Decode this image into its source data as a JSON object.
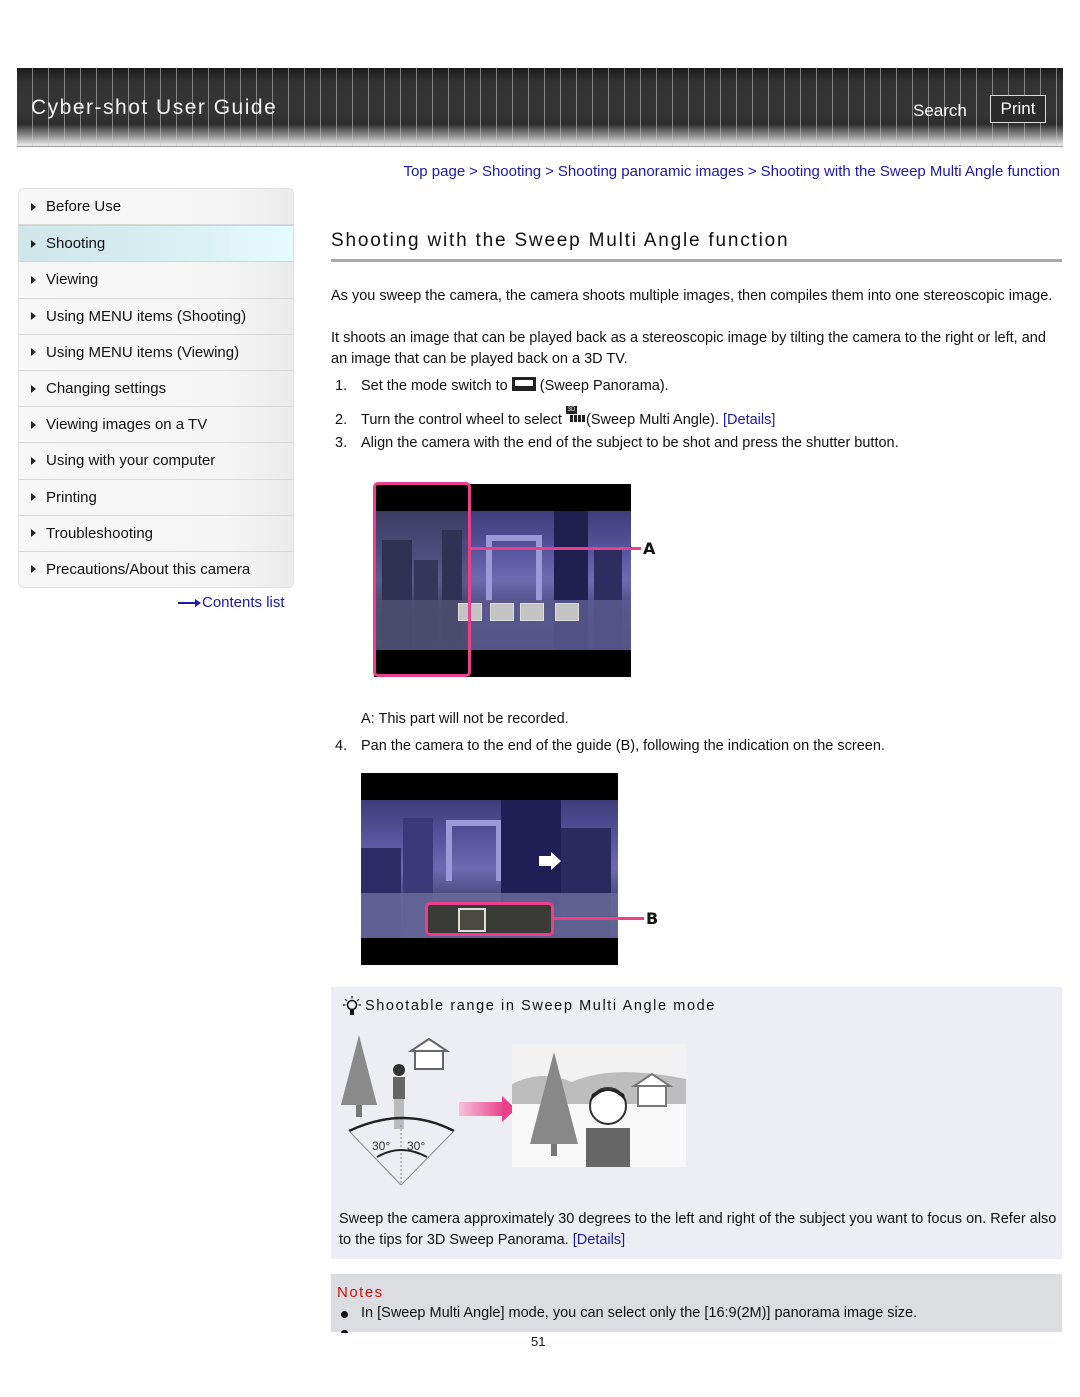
{
  "header": {
    "app_title": "Cyber-shot User Guide",
    "search_label": "Search",
    "print_label": "Print"
  },
  "breadcrumb": {
    "items": [
      "Top page",
      "Shooting",
      "Shooting panoramic images",
      "Shooting with the Sweep Multi Angle function"
    ],
    "separator": ">"
  },
  "sidebar": {
    "items": [
      {
        "label": "Before Use",
        "active": false
      },
      {
        "label": "Shooting",
        "active": true
      },
      {
        "label": "Viewing",
        "active": false
      },
      {
        "label": "Using MENU items (Shooting)",
        "active": false
      },
      {
        "label": "Using MENU items (Viewing)",
        "active": false
      },
      {
        "label": "Changing settings",
        "active": false
      },
      {
        "label": "Viewing images on a TV",
        "active": false
      },
      {
        "label": "Using with your computer",
        "active": false
      },
      {
        "label": "Printing",
        "active": false
      },
      {
        "label": "Troubleshooting",
        "active": false
      },
      {
        "label": "Precautions/About this camera",
        "active": false
      }
    ],
    "contents_list_label": "Contents list"
  },
  "main": {
    "title": "Shooting with the Sweep Multi Angle function",
    "intro_1": "As you sweep the camera, the camera shoots multiple images, then compiles them into one stereoscopic image.",
    "intro_2": "It shoots an image that can be played back as a stereoscopic image by tilting the camera to the right or left, and an image that can be played back on a 3D TV.",
    "steps": [
      {
        "num": "1.",
        "before": "Set the mode switch to",
        "icon": "sweep-panorama-icon",
        "after": "(Sweep Panorama)."
      },
      {
        "num": "2.",
        "before": "Turn the control wheel to select",
        "icon": "sweep-multi-angle-icon",
        "after": "(Sweep Multi Angle).",
        "link": "[Details]"
      },
      {
        "num": "3.",
        "text": "Align the camera with the end of the subject to be shot and press the shutter button."
      },
      {
        "num": "4.",
        "text": "Pan the camera to the end of the guide (B), following the indication on the screen."
      }
    ],
    "figure_a": {
      "label": "A",
      "caption": "A: This part will not be recorded."
    },
    "figure_b": {
      "label": "B"
    },
    "icon_3d_text": "3D"
  },
  "tip": {
    "title": "Shootable range in Sweep Multi Angle mode",
    "angle_left": "30°",
    "angle_right": "30°",
    "text": "Sweep the camera approximately 30 degrees to the left and right of the subject you want to focus on. Refer also to the tips for 3D Sweep Panorama.",
    "link": "[Details]"
  },
  "notes": {
    "title": "Notes",
    "items": [
      "In [Sweep Multi Angle] mode, you can select only the [16:9(2M)] panorama image size."
    ]
  },
  "footer": {
    "page_number": "51"
  },
  "colors": {
    "link": "#1a1aaa",
    "accent_pink": "#e8408a",
    "notes_title": "#cc1111",
    "active_nav": "#d6eef2"
  }
}
